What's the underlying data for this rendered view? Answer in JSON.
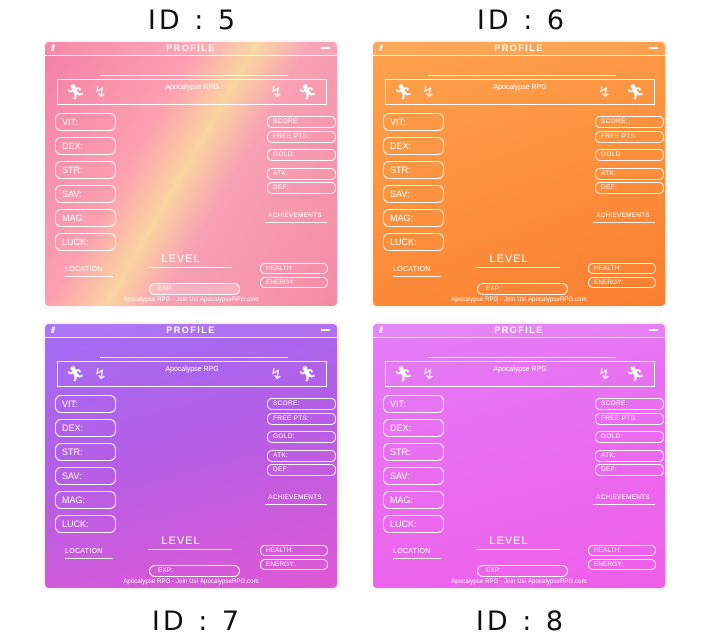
{
  "labels": {
    "id5": "ID : 5",
    "id6": "ID : 6",
    "id7": "ID : 7",
    "id8": "ID : 8"
  },
  "profile": {
    "title": "PROFILE",
    "grip": "//",
    "game_name": "Apocalypse RPG",
    "stats": [
      "VIT:",
      "DEX:",
      "STR:",
      "SAV:",
      "MAG:",
      "LUCK:"
    ],
    "info": [
      "SCORE:",
      "FREE PTS:",
      "GOLD:",
      "ATK:",
      "DEF:"
    ],
    "achievements": "ACHIEVEMENTS",
    "location": "LOCATION",
    "level": "LEVEL",
    "exp": "EXP:",
    "health": "HEALTH:",
    "energy": "ENERGY:",
    "footer": "Apocalypse RPG - Join Us! ApocalypseRPG.com"
  },
  "colors": {
    "id5": "#f58ba6",
    "id6": "#fd8e3b",
    "id7": "#b45ee6",
    "id8": "#ea6cf0"
  },
  "icons": [
    "running-figure-icon",
    "sprinting-figure-icon"
  ]
}
